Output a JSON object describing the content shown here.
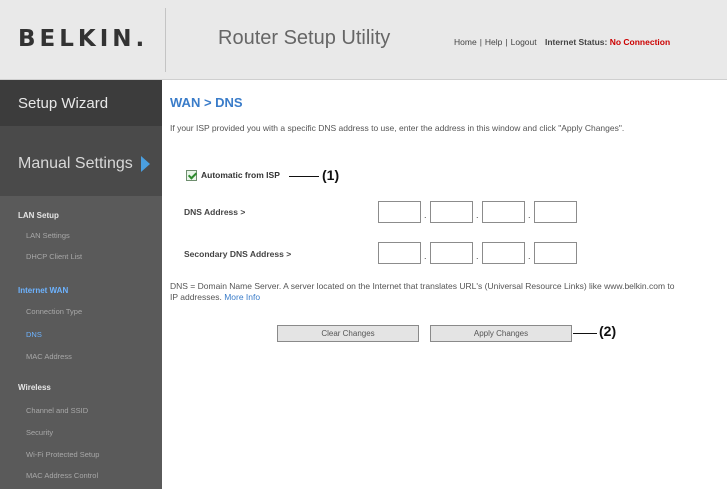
{
  "header": {
    "logo": "BELKIN.",
    "title": "Router Setup Utility",
    "links": [
      "Home",
      "Help",
      "Logout"
    ],
    "status_label": "Internet Status:",
    "status_value": "No Connection"
  },
  "sidebar": {
    "wizard": "Setup Wizard",
    "manual": "Manual Settings",
    "sections": [
      {
        "title": "LAN Setup",
        "items": [
          "LAN Settings",
          "DHCP Client List"
        ]
      },
      {
        "title": "Internet WAN",
        "items": [
          "Connection Type",
          "DNS",
          "MAC Address"
        ]
      },
      {
        "title": "Wireless",
        "items": [
          "Channel and SSID",
          "Security",
          "Wi-Fi Protected Setup",
          "MAC Address Control"
        ]
      }
    ]
  },
  "main": {
    "breadcrumb": "WAN > DNS",
    "description": "If your ISP provided you with a specific DNS address to use, enter the address in this window and click \"Apply Changes\".",
    "auto_label": "Automatic from ISP",
    "auto_checked": true,
    "dns_label": "DNS Address >",
    "dns_values": [
      "",
      "",
      "",
      ""
    ],
    "secondary_label": "Secondary DNS Address >",
    "secondary_values": [
      "",
      "",
      "",
      ""
    ],
    "note": "DNS = Domain Name Server. A server located on the Internet that translates URL's (Universal Resource Links) like www.belkin.com to IP addresses.",
    "more_info": "More Info",
    "clear_button": "Clear Changes",
    "apply_button": "Apply Changes"
  },
  "callouts": {
    "one": "(1)",
    "two": "(2)"
  },
  "colors": {
    "accent": "#3a7cc9",
    "active_nav": "#6db3ff",
    "status_error": "#cc0000",
    "sidebar_bg": "#5a5a5a"
  }
}
